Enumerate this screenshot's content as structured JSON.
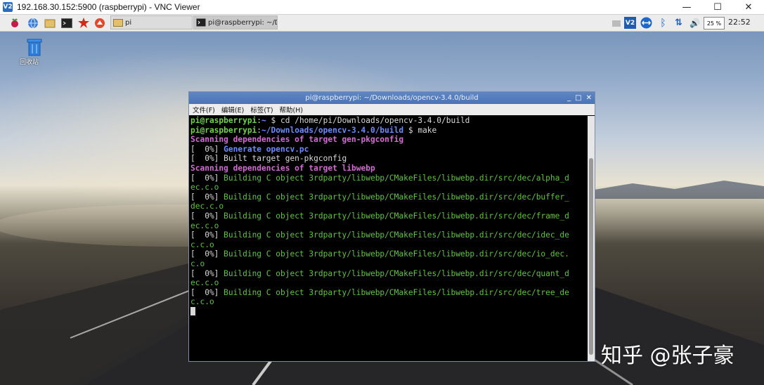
{
  "vnc": {
    "title": "192.168.30.152:5900 (raspberrypi) - VNC Viewer",
    "logo": "V2",
    "minimize": "—",
    "maximize": "☐",
    "close": "✕"
  },
  "panel": {
    "launchers": [
      "raspberry-icon",
      "web-browser-icon",
      "file-manager-icon",
      "terminal-icon",
      "mathematica-icon",
      "wolfram-icon"
    ],
    "tasks": [
      {
        "label": "pi"
      },
      {
        "label": "pi@raspberrypi: ~/Do..."
      }
    ],
    "tray": {
      "cpu_label": "25 %",
      "clock": "22:52"
    }
  },
  "desktop": {
    "trash_label": "回收站"
  },
  "terminal": {
    "title": "pi@raspberrypi: ~/Downloads/opencv-3.4.0/build",
    "controls": [
      "_",
      "□",
      "✕"
    ],
    "menu": [
      "文件(F)",
      "编辑(E)",
      "标签(T)",
      "帮助(H)"
    ],
    "lines": [
      [
        {
          "c": "g",
          "t": "pi@raspberrypi"
        },
        {
          "c": "w",
          "t": ":"
        },
        {
          "c": "b",
          "t": "~"
        },
        {
          "c": "w",
          "t": " $ cd /home/pi/Downloads/opencv-3.4.0/build"
        }
      ],
      [
        {
          "c": "g",
          "t": "pi@raspberrypi"
        },
        {
          "c": "w",
          "t": ":"
        },
        {
          "c": "b",
          "t": "~/Downloads/opencv-3.4.0/build"
        },
        {
          "c": "w",
          "t": " $ make"
        }
      ],
      [
        {
          "c": "m",
          "t": "Scanning dependencies of target gen-pkgconfig"
        }
      ],
      [
        {
          "c": "w",
          "t": "[  0%] "
        },
        {
          "c": "b",
          "t": "Generate opencv.pc"
        }
      ],
      [
        {
          "c": "w",
          "t": "[  0%] Built target gen-pkgconfig"
        }
      ],
      [
        {
          "c": "m",
          "t": "Scanning dependencies of target libwebp"
        }
      ],
      [
        {
          "c": "w",
          "t": "[  0%] "
        },
        {
          "c": "gn",
          "t": "Building C object 3rdparty/libwebp/CMakeFiles/libwebp.dir/src/dec/alpha_d"
        }
      ],
      [
        {
          "c": "gn",
          "t": "ec.c.o"
        }
      ],
      [
        {
          "c": "w",
          "t": "[  0%] "
        },
        {
          "c": "gn",
          "t": "Building C object 3rdparty/libwebp/CMakeFiles/libwebp.dir/src/dec/buffer_"
        }
      ],
      [
        {
          "c": "gn",
          "t": "dec.c.o"
        }
      ],
      [
        {
          "c": "w",
          "t": "[  0%] "
        },
        {
          "c": "gn",
          "t": "Building C object 3rdparty/libwebp/CMakeFiles/libwebp.dir/src/dec/frame_d"
        }
      ],
      [
        {
          "c": "gn",
          "t": "ec.c.o"
        }
      ],
      [
        {
          "c": "w",
          "t": "[  0%] "
        },
        {
          "c": "gn",
          "t": "Building C object 3rdparty/libwebp/CMakeFiles/libwebp.dir/src/dec/idec_de"
        }
      ],
      [
        {
          "c": "gn",
          "t": "c.c.o"
        }
      ],
      [
        {
          "c": "w",
          "t": "[  0%] "
        },
        {
          "c": "gn",
          "t": "Building C object 3rdparty/libwebp/CMakeFiles/libwebp.dir/src/dec/io_dec."
        }
      ],
      [
        {
          "c": "gn",
          "t": "c.o"
        }
      ],
      [
        {
          "c": "w",
          "t": "[  0%] "
        },
        {
          "c": "gn",
          "t": "Building C object 3rdparty/libwebp/CMakeFiles/libwebp.dir/src/dec/quant_d"
        }
      ],
      [
        {
          "c": "gn",
          "t": "ec.c.o"
        }
      ],
      [
        {
          "c": "w",
          "t": "[  0%] "
        },
        {
          "c": "gn",
          "t": "Building C object 3rdparty/libwebp/CMakeFiles/libwebp.dir/src/dec/tree_de"
        }
      ],
      [
        {
          "c": "gn",
          "t": "c.c.o"
        }
      ]
    ]
  },
  "watermark": "知乎 @张子豪",
  "colors": {
    "prompt_user": "#6fd34a",
    "prompt_path": "#6a8cff",
    "scanning": "#d46ad4",
    "building": "#5cc43a"
  }
}
